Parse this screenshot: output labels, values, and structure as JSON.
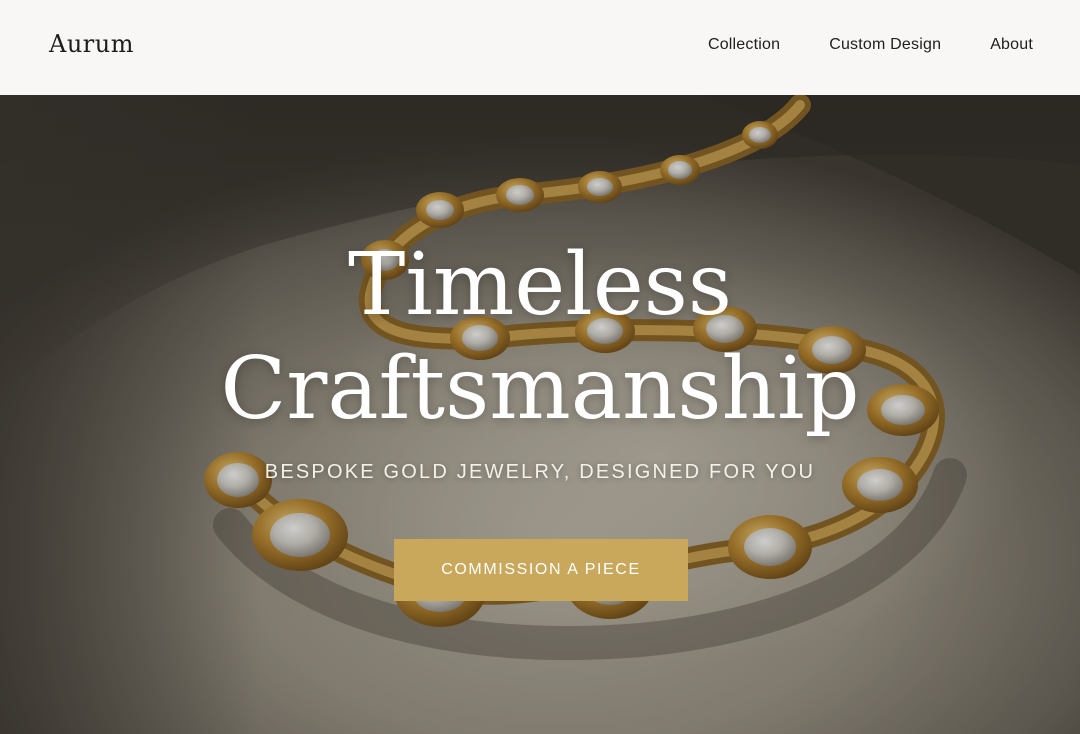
{
  "brand": {
    "logo_text": "Aurum"
  },
  "nav": {
    "items": [
      {
        "label": "Collection"
      },
      {
        "label": "Custom Design"
      },
      {
        "label": "About"
      }
    ]
  },
  "hero": {
    "title_line1": "Timeless",
    "title_line2": "Craftsmanship",
    "subtitle": "BESPOKE GOLD JEWELRY, DESIGNED FOR YOU",
    "cta_label": "COMMISSION A PIECE",
    "background_image": "gold-bracelet-photo"
  },
  "colors": {
    "header_bg": "#f8f7f5",
    "accent_gold": "#c9a85c",
    "text_dark": "#22201d",
    "hero_text": "#ffffff"
  }
}
